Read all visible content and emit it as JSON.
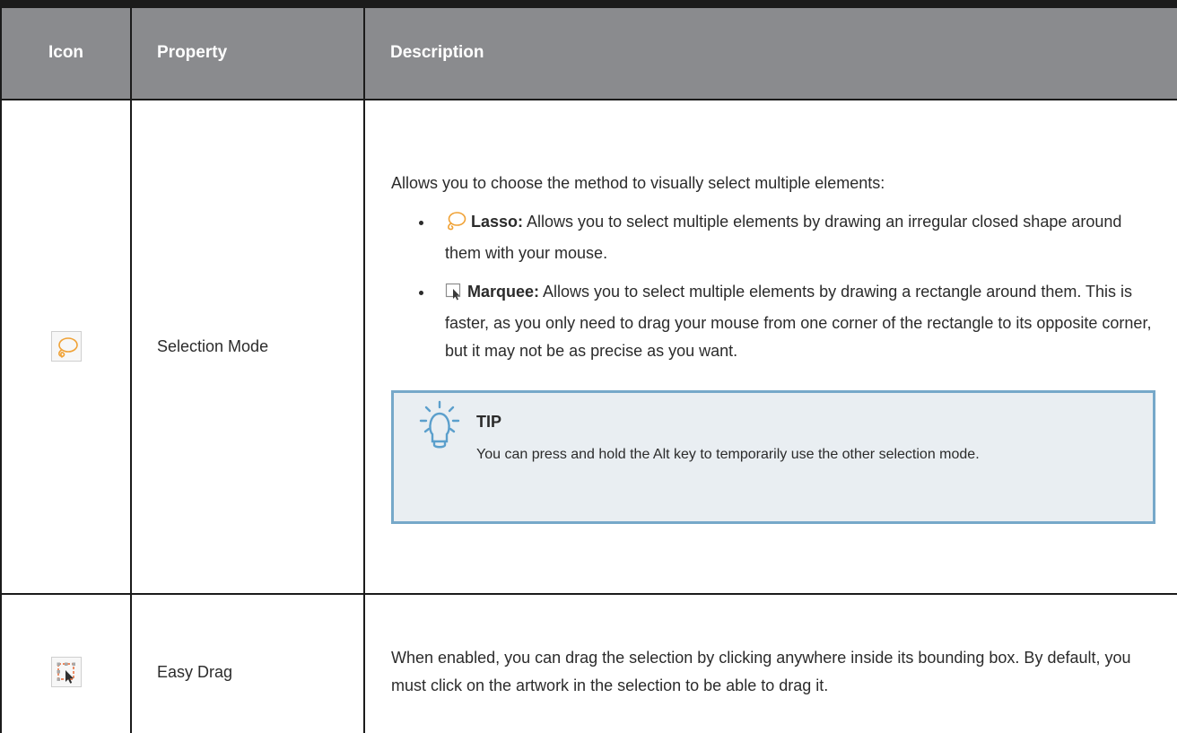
{
  "table": {
    "headers": {
      "icon": "Icon",
      "property": "Property",
      "description": "Description"
    },
    "rows": [
      {
        "icon": "lasso-icon",
        "property": "Selection Mode",
        "description": "Allows you to choose the method to visually select multiple elements:",
        "options": [
          {
            "icon": "lasso-icon",
            "name": "Lasso:",
            "text": "Allows you to select multiple elements by drawing an irregular closed shape around them with your mouse."
          },
          {
            "icon": "marquee-icon",
            "name": "Marquee:",
            "text": "Allows you to select multiple elements by drawing a rectangle around them. This is faster, as you only need to drag your mouse from one corner of the rectangle to its opposite corner, but it may not be as precise as you want."
          }
        ],
        "tip": {
          "icon": "lightbulb-icon",
          "title": "TIP",
          "text": "You can press and hold the Alt key to temporarily use the other selection mode."
        }
      },
      {
        "icon": "easy-drag-icon",
        "property": "Easy Drag",
        "description": "When enabled, you can drag the selection by clicking anywhere inside its bounding box. By default, you must click on the artwork in the selection to be able to drag it."
      }
    ]
  },
  "colors": {
    "header_bg": "#8a8b8e",
    "header_text": "#ffffff",
    "border": "#1b1b1b",
    "tip_bg": "#e9eef2",
    "tip_border": "#76a8c9",
    "lasso_orange": "#f0a236",
    "easy_drag_orange": "#e8622c"
  }
}
